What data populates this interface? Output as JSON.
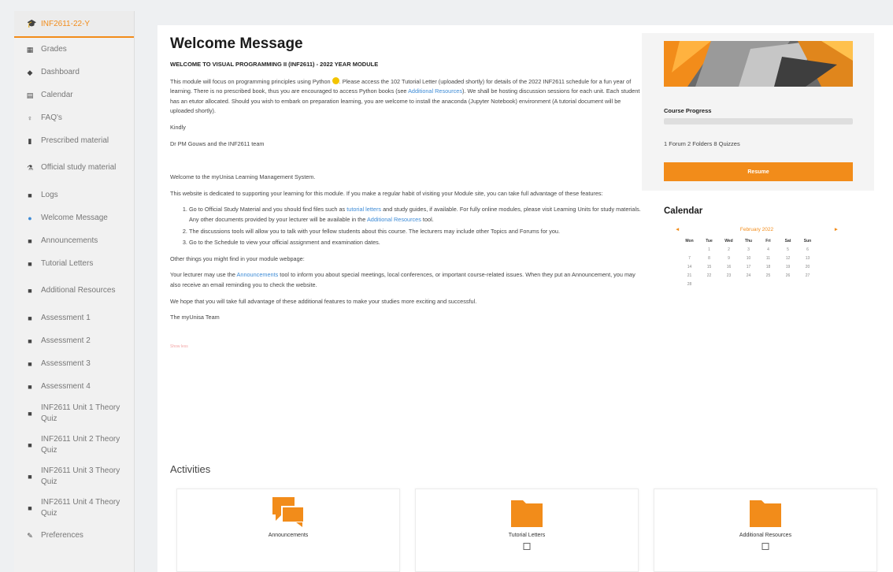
{
  "sidebar": {
    "course": "INF2611-22-Y",
    "items": [
      {
        "label": "Grades",
        "icon": "grid-icon",
        "glyph": "▦",
        "h": "h1"
      },
      {
        "label": "Dashboard",
        "icon": "dashboard-icon",
        "glyph": "◆",
        "h": "h1"
      },
      {
        "label": "Calendar",
        "icon": "calendar-icon",
        "glyph": "▤",
        "h": "h1"
      },
      {
        "label": "FAQ's",
        "icon": "lightbulb-icon",
        "glyph": "♀",
        "h": "h1"
      },
      {
        "label": "Prescribed material",
        "icon": "bookmark-icon",
        "glyph": "▮",
        "h": "h1"
      },
      {
        "label": "Official study material",
        "icon": "flask-icon",
        "glyph": "⚗",
        "h": "h2"
      },
      {
        "label": "Logs",
        "icon": "folder-icon",
        "glyph": "■",
        "h": "h1"
      },
      {
        "label": "Welcome Message",
        "icon": "info-icon",
        "glyph": "●",
        "h": "h1"
      },
      {
        "label": "Announcements",
        "icon": "folder-icon",
        "glyph": "■",
        "h": "h1"
      },
      {
        "label": "Tutorial Letters",
        "icon": "folder-icon",
        "glyph": "■",
        "h": "h1"
      },
      {
        "label": "Additional Resources",
        "icon": "folder-icon",
        "glyph": "■",
        "h": "h2"
      },
      {
        "label": "Assessment 1",
        "icon": "folder-icon",
        "glyph": "■",
        "h": "h1"
      },
      {
        "label": "Assessment 2",
        "icon": "folder-icon",
        "glyph": "■",
        "h": "h1"
      },
      {
        "label": "Assessment 3",
        "icon": "folder-icon",
        "glyph": "■",
        "h": "h1"
      },
      {
        "label": "Assessment 4",
        "icon": "folder-icon",
        "glyph": "■",
        "h": "h1"
      },
      {
        "label": "INF2611 Unit 1 Theory Quiz",
        "icon": "folder-icon",
        "glyph": "■",
        "h": "h2"
      },
      {
        "label": "INF2611 Unit 2 Theory Quiz",
        "icon": "folder-icon",
        "glyph": "■",
        "h": "h2"
      },
      {
        "label": "INF2611 Unit 3 Theory Quiz",
        "icon": "folder-icon",
        "glyph": "■",
        "h": "h2"
      },
      {
        "label": "INF2611 Unit 4 Theory Quiz",
        "icon": "folder-icon",
        "glyph": "■",
        "h": "h2"
      },
      {
        "label": "Preferences",
        "icon": "wrench-icon",
        "glyph": "✎",
        "h": "h1"
      }
    ]
  },
  "main": {
    "title": "Welcome Message",
    "subtitle": "WELCOME TO VISUAL PROGRAMMING II (INF2611) - 2022 YEAR MODULE",
    "p1a": "This module will focus on programming principles using Python",
    "p1b": ". Please access the 102 Tutorial Letter (uploaded shortly) for details of the 2022 INF2611 schedule for a fun year of learning. There is no prescribed book, thus you are encouraged to access Python books (see ",
    "p1_link": "Additional Resources",
    "p1c": "). We shall be hosting discussion sessions for each unit. Each student has an etutor allocated. Should you wish to embark on preparation learning, you are welcome to install the anaconda (Jupyter Notebook) environment (A tutorial document will be uploaded shortly).",
    "kindly": "Kindly",
    "signoff": "Dr PM Gouws and the INF2611 team",
    "welcome": "Welcome to the myUnisa Learning Management System.",
    "p2": "This website is dedicated to supporting your learning for this module. If you make a regular habit of visiting your Module site, you can take full advantage of these features:",
    "li1a": "Go to Official Study Material and you should find files such as ",
    "li1_link1": "tutorial letters",
    "li1b": " and study guides, if available. For fully online modules, please visit Learning Units for study materials. Any other documents provided by your lecturer will be available in the ",
    "li1_link2": "Additional Resources",
    "li1c": " tool.",
    "li2": "The discussions tools will allow you to talk with your fellow students about this course. The lecturers may include other Topics and Forums for you.",
    "li3": "Go to the Schedule to view your official assignment and examination dates.",
    "other": "Other things you might find in your module webpage:",
    "p3a": "Your lecturer may use the ",
    "p3_link": "Announcements",
    "p3b": " tool to inform you about special meetings, local conferences, or important course-related issues. When they put an Announcement, you may also receive an email reminding you to check the website.",
    "p4": "We hope that you will take full advantage of these additional features to make your studies more exciting and successful.",
    "team": "The myUnisa Team",
    "show_less": "Show less"
  },
  "course_panel": {
    "progress_label": "Course Progress",
    "progress_fraction": 0,
    "counts": "1 Forum  2 Folders  8 Quizzes",
    "resume_label": "Resume"
  },
  "calendar": {
    "title": "Calendar",
    "month": "February 2022",
    "prev": "◄",
    "next": "►",
    "days": [
      "Mon",
      "Tue",
      "Wed",
      "Thu",
      "Fri",
      "Sat",
      "Sun"
    ],
    "cells": [
      "",
      "1",
      "2",
      "3",
      "4",
      "5",
      "6",
      "7",
      "8",
      "9",
      "10",
      "11",
      "12",
      "13",
      "14",
      "15",
      "16",
      "17",
      "18",
      "19",
      "20",
      "21",
      "22",
      "23",
      "24",
      "25",
      "26",
      "27",
      "28"
    ]
  },
  "activities": {
    "title": "Activities",
    "cards": [
      {
        "label": "Announcements",
        "icon": "chat-icon",
        "checkbox": false
      },
      {
        "label": "Tutorial Letters",
        "icon": "folder-icon",
        "checkbox": true
      },
      {
        "label": "Additional Resources",
        "icon": "folder-icon",
        "checkbox": true
      }
    ]
  },
  "colors": {
    "accent": "#f28c1a",
    "link": "#3d8bd6"
  }
}
